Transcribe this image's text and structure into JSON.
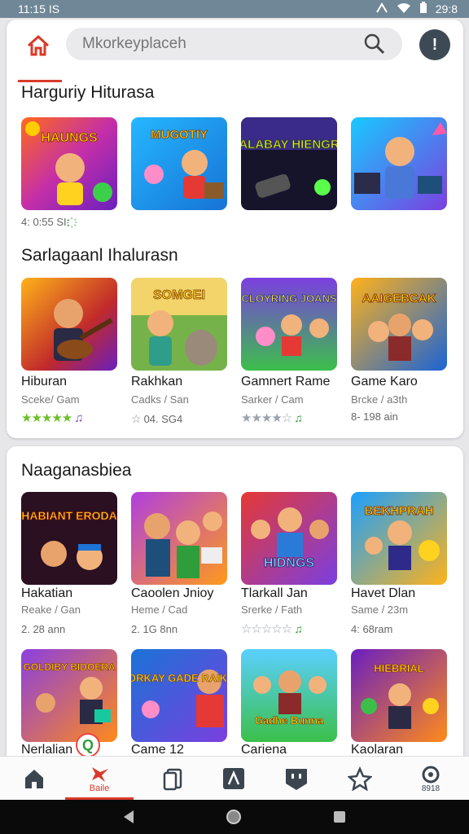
{
  "status_bar": {
    "time": "11:15 IS",
    "battery": "29:8"
  },
  "search": {
    "placeholder": "Mkorkeyplaceh"
  },
  "alert_label": "!",
  "sections": [
    {
      "title": "Harguriy Hiturasa",
      "items": [
        {
          "tile_title": "HAUNGS"
        },
        {
          "tile_title": "MUGOTIY"
        },
        {
          "tile_title": "ALABAY HIENGR"
        },
        {
          "tile_title": ""
        }
      ],
      "meta": "4: 0:55 SI:",
      "meta_icon": "҉"
    },
    {
      "title": "Sarlagaanl Ihalurasn",
      "items": [
        {
          "tile_title": "",
          "name": "Hiburan",
          "sub": "Sceke/ Gam",
          "rating_style": "green",
          "stars": "★★★★★",
          "note": "♫"
        },
        {
          "tile_title": "SOMGEI",
          "name": "Rakhkan",
          "sub": "Cadks / San",
          "rating_style": "outline",
          "meta": "04. SG4"
        },
        {
          "tile_title": "CLOYRING JOANS",
          "name": "Gamnert Rame",
          "sub": "Sarker / Cam",
          "rating_style": "grey",
          "stars": "★★★★☆",
          "note": "♫"
        },
        {
          "tile_title": "AAIGEBCAK",
          "name": "Game Karo",
          "sub": "Brcke / a3th",
          "meta": "8- 198 ain"
        }
      ]
    },
    {
      "title": "Naaganasbiea",
      "items": [
        {
          "tile_title": "KHABIANT ERODAK",
          "name": "Hakatian",
          "sub": "Reake / Gan",
          "meta": "2. 28 ann"
        },
        {
          "tile_title": "",
          "name": "Caoolen Jnioy",
          "sub": "Heme / Cad",
          "meta": "2. 1G 8nn"
        },
        {
          "tile_title": "HIDNGS",
          "name": "Tlarkall Jan",
          "sub": "Srerke / Fath",
          "rating_style": "grey",
          "stars": "☆☆☆☆☆",
          "note": "♫"
        },
        {
          "tile_title": "BEKHPRAH",
          "name": "Havet Dlan",
          "sub": "Same / 23m",
          "meta": "4: 68ram"
        }
      ]
    },
    {
      "items": [
        {
          "tile_title": "GOLDIBY BIDOERA",
          "name": "Nerlalian"
        },
        {
          "tile_title": "GORKAY GADE RAIK",
          "name": "Came 12"
        },
        {
          "tile_title": "Gadhe Bunna",
          "name": "Cariena"
        },
        {
          "tile_title": "HIEBRIAL",
          "name": "Kaolaran"
        }
      ]
    }
  ],
  "badge_glyph": "Q",
  "bottom_nav": {
    "items": [
      {
        "icon": "home-icon"
      },
      {
        "icon": "games-icon",
        "label": "Baile"
      },
      {
        "icon": "copy-icon"
      },
      {
        "icon": "puzzle-icon"
      },
      {
        "icon": "shop-icon"
      },
      {
        "icon": "star-icon"
      },
      {
        "icon": "settings-icon",
        "label": "8918"
      }
    ]
  },
  "colors": {
    "accent": "#d93a2b",
    "status_bar": "#6f8797",
    "alert_button": "#3d4a55"
  }
}
